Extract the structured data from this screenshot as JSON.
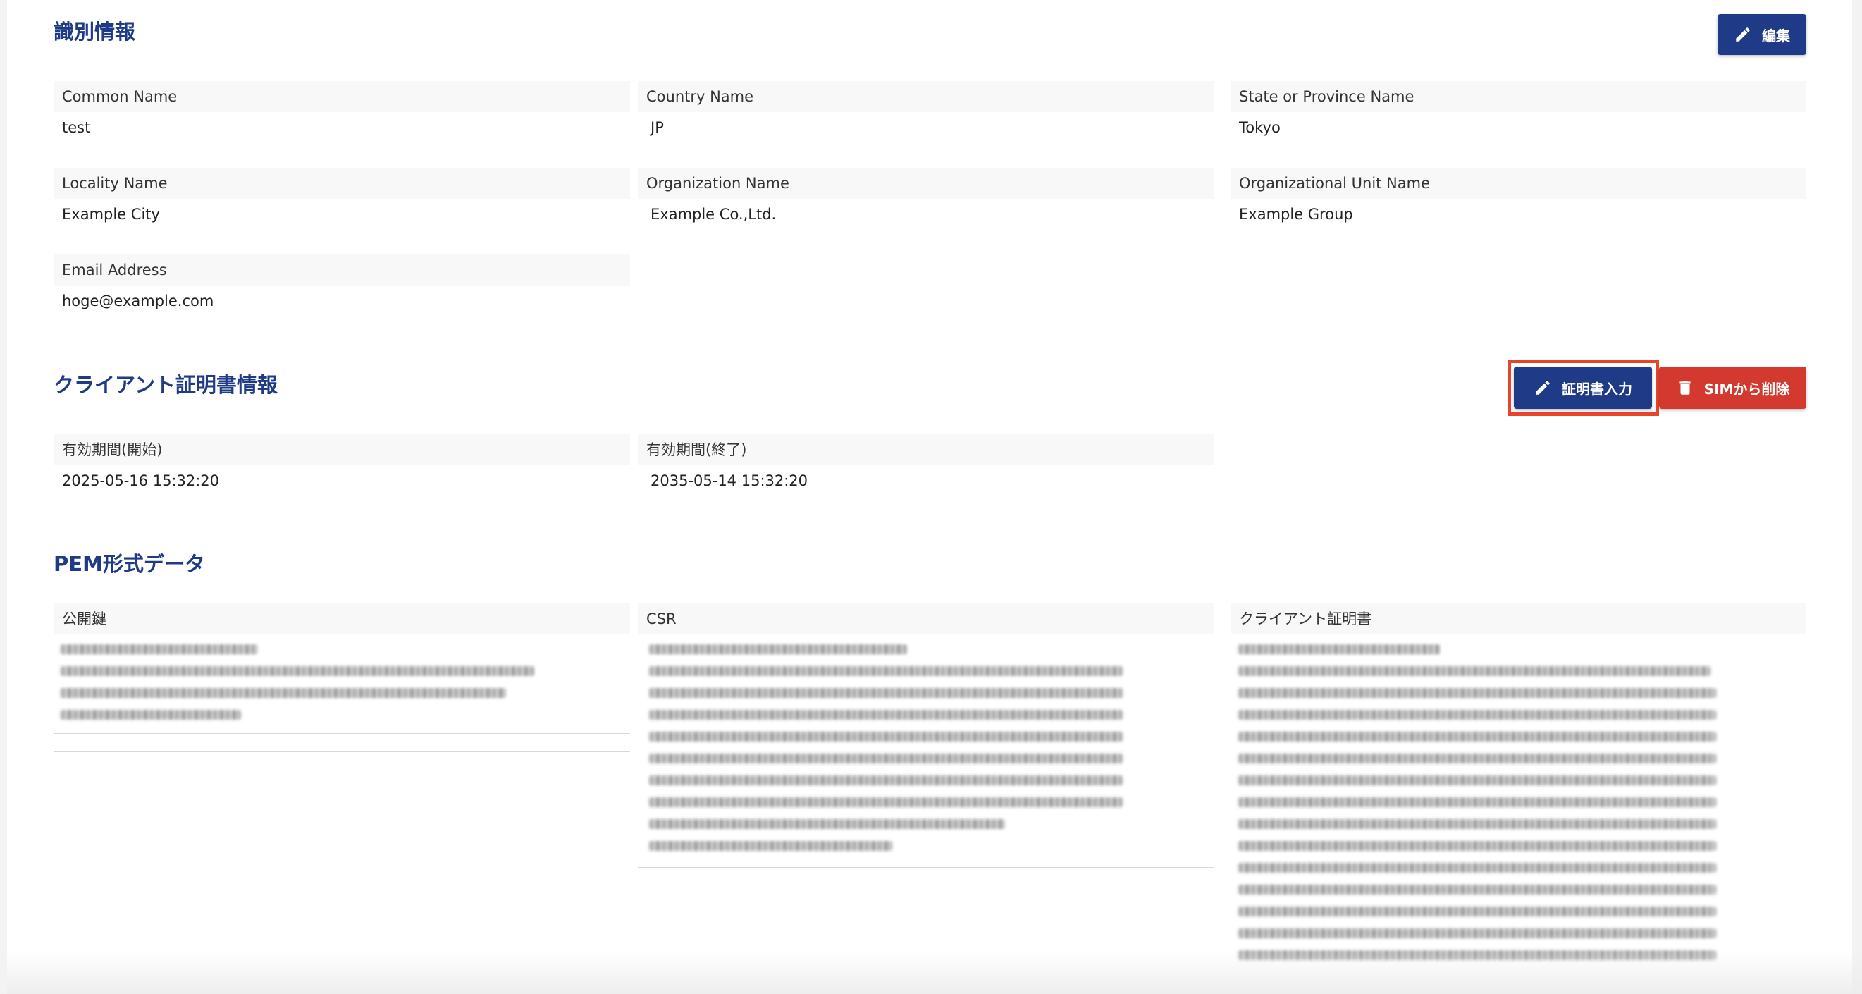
{
  "identity": {
    "title": "識別情報",
    "edit_label": "編集",
    "fields": [
      {
        "label": "Common Name",
        "value": "test"
      },
      {
        "label": "Country Name",
        "value": "JP"
      },
      {
        "label": "State or Province Name",
        "value": "Tokyo"
      },
      {
        "label": "Locality Name",
        "value": "Example City"
      },
      {
        "label": "Organization Name",
        "value": "Example Co.,Ltd."
      },
      {
        "label": "Organizational Unit Name",
        "value": "Example Group"
      },
      {
        "label": "Email Address",
        "value": "hoge@example.com"
      }
    ]
  },
  "client_cert": {
    "title": "クライアント証明書情報",
    "input_label": "証明書入力",
    "delete_label": "SIMから削除",
    "fields": [
      {
        "label": "有効期間(開始)",
        "value": "2025-05-16 15:32:20"
      },
      {
        "label": "有効期間(終了)",
        "value": "2035-05-14 15:32:20"
      }
    ]
  },
  "pem": {
    "title": "PEM形式データ",
    "columns": [
      {
        "label": "公開鍵"
      },
      {
        "label": "CSR"
      },
      {
        "label": "クライアント証明書"
      }
    ]
  },
  "icons": {
    "edit": "pencil-icon",
    "delete": "trash-icon"
  },
  "colors": {
    "primary": "#1f3a86",
    "danger": "#d3392f",
    "highlight": "#e8442a"
  }
}
